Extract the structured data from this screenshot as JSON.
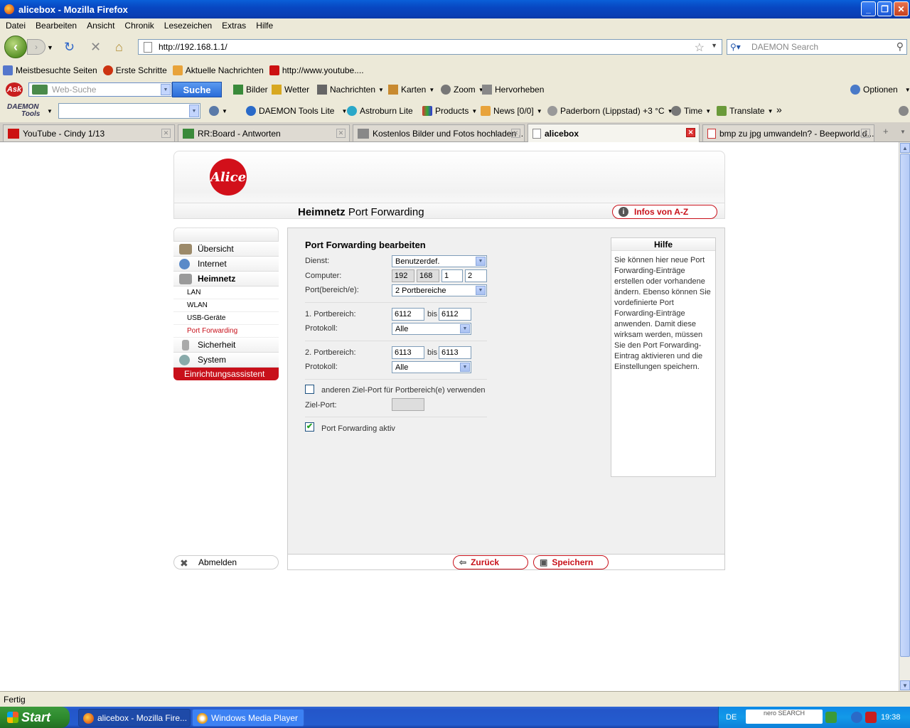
{
  "window": {
    "title": "alicebox - Mozilla Firefox",
    "minimize": "_",
    "maximize": "❐",
    "close": "✕"
  },
  "menu": [
    "Datei",
    "Bearbeiten",
    "Ansicht",
    "Chronik",
    "Lesezeichen",
    "Extras",
    "Hilfe"
  ],
  "nav": {
    "url": "http://192.168.1.1/",
    "search_placeholder": "DAEMON Search"
  },
  "bookmarks": [
    {
      "label": "Meistbesuchte Seiten",
      "color": "#5577cc"
    },
    {
      "label": "Erste Schritte",
      "color": "#cc3311"
    },
    {
      "label": "Aktuelle Nachrichten",
      "color": "#e8a33a"
    },
    {
      "label": "http://www.youtube....",
      "color": "#cc1111"
    }
  ],
  "ask_toolbar": {
    "search_placeholder": "Web-Suche",
    "search_button": "Suche",
    "items": [
      {
        "label": "Bilder",
        "icon": "images-icon"
      },
      {
        "label": "Wetter",
        "icon": "weather-icon"
      },
      {
        "label": "Nachrichten",
        "icon": "news-icon"
      },
      {
        "label": "Karten",
        "icon": "maps-icon"
      },
      {
        "label": "Zoom",
        "icon": "zoom-icon"
      },
      {
        "label": "Hervorheben",
        "icon": "highlight-icon"
      }
    ],
    "options": "Optionen"
  },
  "daemon_toolbar": {
    "logo_line1": "DAEMON",
    "logo_line2": "Tools",
    "items": [
      {
        "label": "DAEMON Tools Lite",
        "icon": "daemon-icon"
      },
      {
        "label": "Astroburn Lite",
        "icon": "astroburn-icon"
      },
      {
        "label": "Products",
        "icon": "products-icon"
      },
      {
        "label": "News [0/0]",
        "icon": "rss-icon"
      },
      {
        "label": "Paderborn (Lippstad) +3 °C",
        "icon": "weather-icon"
      },
      {
        "label": "Time",
        "icon": "clock-icon"
      },
      {
        "label": "Translate",
        "icon": "translate-icon"
      }
    ],
    "more": "»"
  },
  "tabs": [
    {
      "label": "YouTube - Cindy 1/13",
      "active": false
    },
    {
      "label": "RR:Board - Antworten",
      "active": false
    },
    {
      "label": "Kostenlos Bilder und Fotos hochladen ...",
      "active": false
    },
    {
      "label": "alicebox",
      "active": true
    },
    {
      "label": "bmp zu jpg umwandeln? - Beepworld.d...",
      "active": false
    }
  ],
  "page": {
    "logo": "Alice",
    "header_bold": "Heimnetz",
    "header_rest": " Port Forwarding",
    "info_button": "Infos von A-Z",
    "sidebar": {
      "items": [
        {
          "label": "Übersicht",
          "bold": false
        },
        {
          "label": "Internet",
          "bold": false
        },
        {
          "label": "Heimnetz",
          "bold": true
        }
      ],
      "sub_items": [
        {
          "label": "LAN",
          "active": false
        },
        {
          "label": "WLAN",
          "active": false
        },
        {
          "label": "USB-Geräte",
          "active": false
        },
        {
          "label": "Port Forwarding",
          "active": true
        }
      ],
      "items_after": [
        {
          "label": "Sicherheit"
        },
        {
          "label": "System"
        }
      ],
      "assistant": "Einrichtungsassistent",
      "logout": "Abmelden"
    },
    "form": {
      "title": "Port Forwarding bearbeiten",
      "dienst_label": "Dienst:",
      "dienst_value": "Benutzerdef.",
      "computer_label": "Computer:",
      "ip": [
        "192",
        "168",
        "1",
        "2"
      ],
      "ports_label": "Port(bereich/e):",
      "ports_value": "2 Portbereiche",
      "range1_label": "1. Portbereich:",
      "range1_from": "6112",
      "range1_to": "6112",
      "bis": "bis",
      "proto_label": "Protokoll:",
      "proto1_value": "Alle",
      "range2_label": "2. Portbereich:",
      "range2_from": "6113",
      "range2_to": "6113",
      "proto2_value": "Alle",
      "other_target_label": "anderen Ziel-Port für Portbereich(e) verwenden",
      "other_target_checked": false,
      "target_port_label": "Ziel-Port:",
      "active_label": "Port Forwarding aktiv",
      "active_checked": true
    },
    "help": {
      "title": "Hilfe",
      "text": "Sie können hier neue Port Forwarding-Einträge erstellen oder vorhandene ändern. Ebenso können Sie vordefinierte Port Forwarding-Einträge anwenden. Damit diese wirksam werden, müssen Sie den Port Forwarding-Eintrag aktivieren und die Einstellungen speichern."
    },
    "buttons": {
      "back": "Zurück",
      "save": "Speichern"
    }
  },
  "status": "Fertig",
  "taskbar": {
    "start": "Start",
    "items": [
      {
        "label": "alicebox - Mozilla Fire...",
        "active": true
      },
      {
        "label": "Windows Media Player",
        "active": false
      }
    ],
    "lang": "DE",
    "nero": "nero SEARCH",
    "clock": "19:38"
  }
}
